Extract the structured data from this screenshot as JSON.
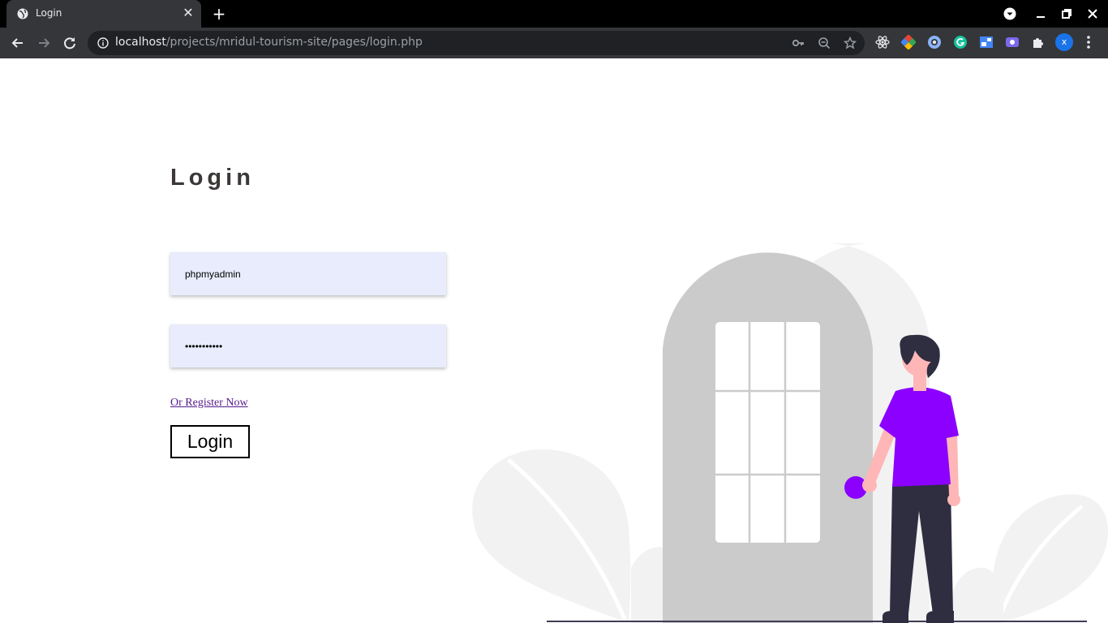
{
  "browser": {
    "tab": {
      "title": "Login"
    },
    "omnibox": {
      "url_host": "localhost",
      "url_path": "/projects/mridul-tourism-site/pages/login.php"
    },
    "profile_initial": "x"
  },
  "page": {
    "title": "Login",
    "username": {
      "value": "phpmyadmin"
    },
    "password": {
      "value": "•••••••••••"
    },
    "register_link": "Or Register Now",
    "login_button": "Login"
  },
  "colors": {
    "accent_purple": "#8b00ff",
    "door_gray": "#cbcbcb",
    "plant_gray": "#f2f2f2",
    "input_bg": "#e8ecfc"
  }
}
